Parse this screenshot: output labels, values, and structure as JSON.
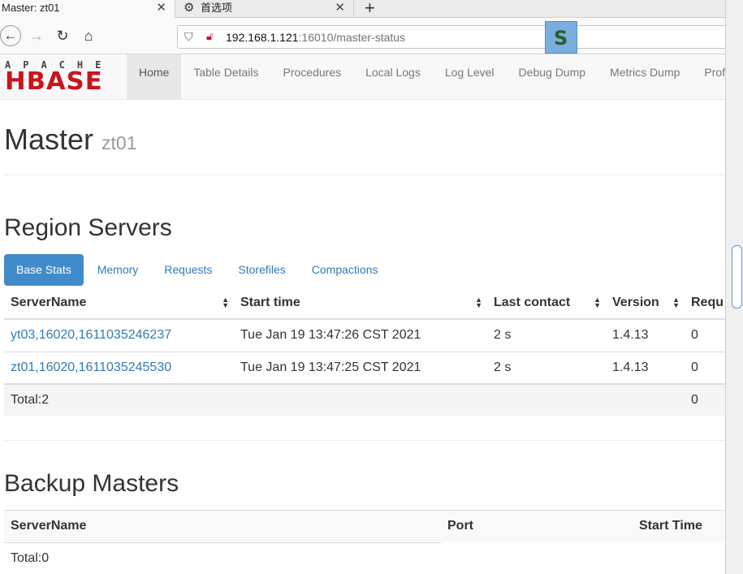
{
  "browser": {
    "tabs": [
      {
        "title": "Master: zt01"
      },
      {
        "title": "首选项"
      }
    ],
    "url_host": "192.168.1.121",
    "url_rest": ":16010/master-status"
  },
  "logo": {
    "top": "APACHE",
    "main": "HBASE"
  },
  "menu": [
    "Home",
    "Table Details",
    "Procedures",
    "Local Logs",
    "Log Level",
    "Debug Dump",
    "Metrics Dump",
    "Profi"
  ],
  "page": {
    "title": "Master",
    "subtitle": "zt01"
  },
  "region_servers": {
    "heading": "Region Servers",
    "tabs": [
      "Base Stats",
      "Memory",
      "Requests",
      "Storefiles",
      "Compactions"
    ],
    "columns": [
      "ServerName",
      "Start time",
      "Last contact",
      "Version",
      "Requ"
    ],
    "rows": [
      {
        "server": "yt03,16020,1611035246237",
        "start": "Tue Jan 19 13:47:26 CST 2021",
        "contact": "2 s",
        "version": "1.4.13",
        "requests": "0"
      },
      {
        "server": "zt01,16020,1611035245530",
        "start": "Tue Jan 19 13:47:25 CST 2021",
        "contact": "2 s",
        "version": "1.4.13",
        "requests": "0"
      }
    ],
    "total_label": "Total:2",
    "total_requests": "0"
  },
  "backup_masters": {
    "heading": "Backup Masters",
    "columns": [
      "ServerName",
      "Port",
      "Start Time"
    ],
    "total_label": "Total:0"
  }
}
